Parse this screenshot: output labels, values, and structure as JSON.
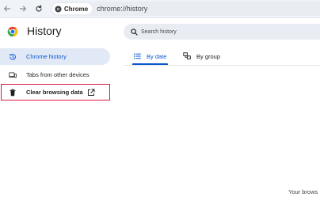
{
  "browser": {
    "chip_label": "Chrome",
    "url": "chrome://history"
  },
  "header": {
    "title": "History"
  },
  "search": {
    "placeholder": "Search history"
  },
  "sidebar": {
    "items": [
      {
        "label": "Chrome history",
        "icon": "history-icon",
        "active": true
      },
      {
        "label": "Tabs from other devices",
        "icon": "devices-icon",
        "active": false
      },
      {
        "label": "Clear browsing data",
        "icon": "trash-icon",
        "trailing_icon": "open-in-new-icon",
        "highlighted": true
      }
    ]
  },
  "tabs": [
    {
      "label": "By date",
      "icon": "list-icon",
      "active": true
    },
    {
      "label": "By group",
      "icon": "group-icon",
      "active": false
    }
  ],
  "footer": {
    "text": "Your brows"
  },
  "colors": {
    "accent": "#0b57d0",
    "active_bg": "#e2e9f6",
    "highlight_border": "#d81b3a",
    "toolbar_bg": "#f0f3f8",
    "search_bg": "#e9edf3"
  }
}
